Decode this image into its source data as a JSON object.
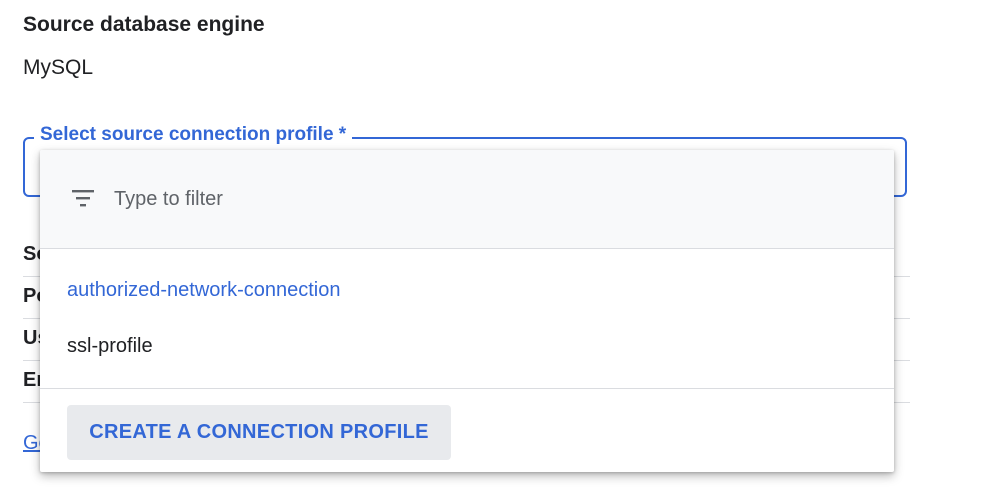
{
  "source_engine": {
    "label": "Source database engine",
    "value": "MySQL"
  },
  "connection_profile_select": {
    "label": "Select source connection profile *"
  },
  "background_rows": [
    "So",
    "Po",
    "Us",
    "En"
  ],
  "background_link": "Ge",
  "dropdown": {
    "filter_placeholder": "Type to filter",
    "options": [
      {
        "label": "authorized-network-connection",
        "selected": true
      },
      {
        "label": "ssl-profile",
        "selected": false
      }
    ],
    "create_button_label": "CREATE A CONNECTION PROFILE"
  },
  "colors": {
    "accent": "#3367d6",
    "text": "#202124",
    "muted": "#5f6368",
    "divider": "#dadce0",
    "button_bg": "#e8eaed"
  }
}
